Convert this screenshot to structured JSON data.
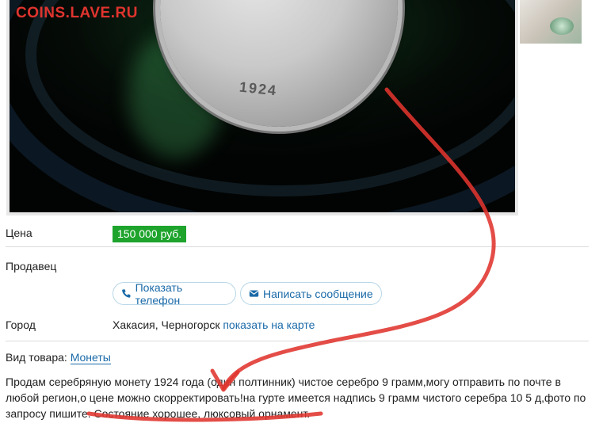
{
  "watermark": "COINS.LAVE.RU",
  "photo": {
    "coin_year": "1924",
    "brand_text": ""
  },
  "thumbnail": {
    "icon": "coin-thumbnail-image"
  },
  "price": {
    "label": "Цена",
    "value": "150 000 руб."
  },
  "seller": {
    "label": "Продавец",
    "show_phone": "Показать телефон",
    "write_message": "Написать сообщение",
    "phone_icon": "phone-icon",
    "mail_icon": "envelope-icon"
  },
  "city": {
    "label": "Город",
    "value": "Хакасия, Черногорск",
    "map_link": "показать на карте"
  },
  "item_type": {
    "label": "Вид товара:",
    "value": "Монеты"
  },
  "description": "Продам серебряную монету 1924 года (один полтинник) чистое серебро 9 грамм,могу отправить по почте в любой регион,о цене можно скорректировать!на гурте имеется надпись 9 грамм чистого серебра 10 5 д,фото по запросу пишите. Состояние хорошее, люксовый орнамент.",
  "colors": {
    "accent_link": "#1a6aa8",
    "price_badge": "#1ea42d",
    "annotation": "#e0342e",
    "watermark": "#e0342e"
  }
}
